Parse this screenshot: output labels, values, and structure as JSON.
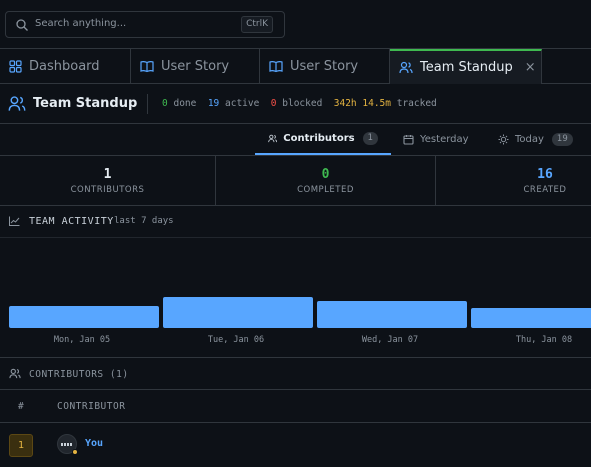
{
  "search": {
    "placeholder": "Search anything...",
    "shortcut": "CtrlK"
  },
  "tabs": [
    {
      "label": "Dashboard",
      "icon": "grid-icon"
    },
    {
      "label": "User Story",
      "icon": "book-icon"
    },
    {
      "label": "User Story",
      "icon": "book-icon"
    },
    {
      "label": "Team Standup",
      "icon": "users-icon",
      "active": true,
      "close": "×"
    }
  ],
  "header": {
    "title": "Team Standup",
    "done_count": "0",
    "done_label": "done",
    "active_count": "19",
    "active_label": "active",
    "blocked_count": "0",
    "blocked_label": "blocked",
    "tracked_a": "342h",
    "tracked_b": "14.5m",
    "tracked_label": "tracked"
  },
  "subtabs": [
    {
      "label": "Contributors",
      "count": "1",
      "active": true
    },
    {
      "label": "Yesterday",
      "count": ""
    },
    {
      "label": "Today",
      "count": "19"
    }
  ],
  "stats": [
    {
      "value": "1",
      "label": "CONTRIBUTORS",
      "color": "#e6edf3"
    },
    {
      "value": "0",
      "label": "COMPLETED",
      "color": "#3fb950"
    },
    {
      "value": "16",
      "label": "CREATED",
      "color": "#58a6ff"
    }
  ],
  "activity": {
    "title": "TEAM ACTIVITY",
    "subtitle": "last 7 days"
  },
  "chart_data": {
    "type": "bar",
    "categories": [
      "Mon, Jan 05",
      "Tue, Jan 06",
      "Wed, Jan 07",
      "Thu, Jan 08"
    ],
    "values": [
      22,
      31,
      27,
      20
    ],
    "ylim": [
      0,
      100
    ],
    "color": "#58a6ff"
  },
  "contributors": {
    "title": "CONTRIBUTORS",
    "count": "(1)",
    "col_rank": "#",
    "col_name": "CONTRIBUTOR",
    "rows": [
      {
        "rank": "1",
        "name": "You"
      }
    ]
  }
}
